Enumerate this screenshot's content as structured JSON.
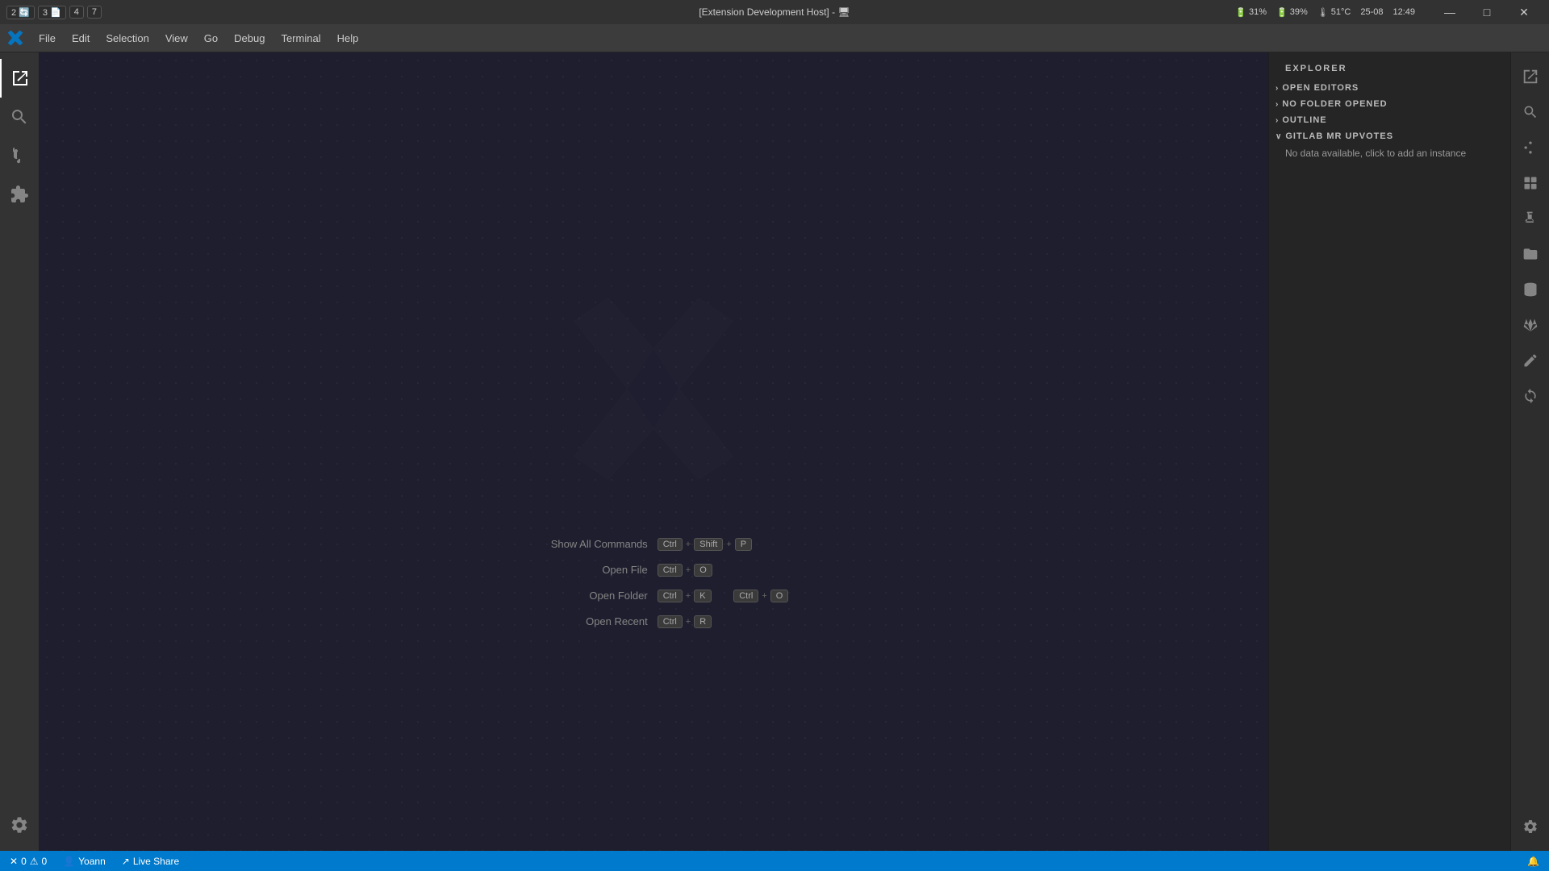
{
  "titlebar": {
    "icons": [
      {
        "label": "2",
        "id": "icon1"
      },
      {
        "label": "3",
        "id": "icon2"
      },
      {
        "label": "4",
        "id": "icon3"
      },
      {
        "label": "7",
        "id": "icon4"
      }
    ],
    "title": "[Extension Development Host] - 🖥",
    "right": {
      "battery": "31%",
      "battery2": "39%",
      "temp": "51°C",
      "time": "12:49",
      "date": "25-08"
    },
    "window_controls": {
      "minimize": "—",
      "maximize": "□",
      "close": "✕"
    }
  },
  "menubar": {
    "items": [
      "File",
      "Edit",
      "Selection",
      "View",
      "Go",
      "Debug",
      "Terminal",
      "Help"
    ]
  },
  "editor": {
    "shortcuts": [
      {
        "label": "Show All Commands",
        "keys": [
          "Ctrl",
          "+",
          "Shift",
          "+",
          "P"
        ]
      },
      {
        "label": "Open File",
        "keys": [
          "Ctrl",
          "+",
          "O"
        ]
      },
      {
        "label": "Open Folder",
        "keys_a": [
          "Ctrl",
          "+",
          "K"
        ],
        "keys_b": [
          "Ctrl",
          "+",
          "O"
        ]
      },
      {
        "label": "Open Recent",
        "keys": [
          "Ctrl",
          "+",
          "R"
        ]
      }
    ]
  },
  "sidebar": {
    "title": "Explorer",
    "sections": [
      {
        "label": "OPEN EDITORS",
        "expanded": false,
        "content": null
      },
      {
        "label": "NO FOLDER OPENED",
        "expanded": false,
        "content": null
      },
      {
        "label": "OUTLINE",
        "expanded": false,
        "content": null
      },
      {
        "label": "GITLAB MR UPVOTES",
        "expanded": true,
        "content": "No data available, click to add an instance"
      }
    ]
  },
  "right_panel": {
    "icons": [
      {
        "name": "explorer-icon",
        "symbol": "⎘"
      },
      {
        "name": "search-icon",
        "symbol": "🔍"
      },
      {
        "name": "source-control-icon",
        "symbol": "⑂"
      },
      {
        "name": "extensions-icon",
        "symbol": "⊞"
      },
      {
        "name": "test-icon",
        "symbol": "⚗"
      },
      {
        "name": "folder-icon",
        "symbol": "🗂"
      },
      {
        "name": "stack-icon",
        "symbol": "⊕"
      },
      {
        "name": "gitlab-icon",
        "symbol": "◈"
      },
      {
        "name": "edit-icon",
        "symbol": "✏"
      },
      {
        "name": "refresh-icon",
        "symbol": "↻"
      },
      {
        "name": "settings-icon",
        "symbol": "⚙"
      }
    ]
  },
  "statusbar": {
    "left": {
      "errors": "0",
      "warnings": "0",
      "user": "Yoann",
      "liveshare": "Live Share"
    },
    "right": {
      "notification": "🔔"
    }
  }
}
